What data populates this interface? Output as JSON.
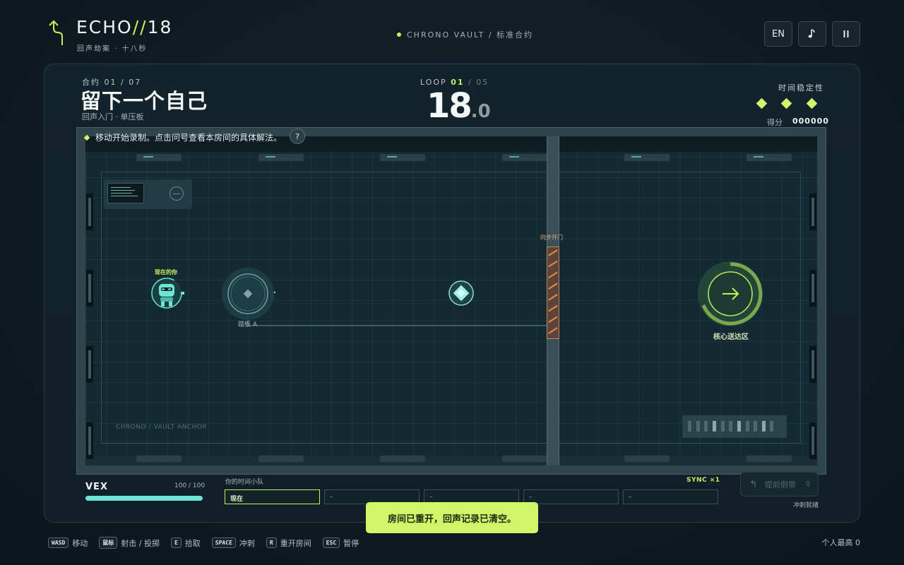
{
  "header": {
    "title_main": "ECHO",
    "title_slash": "//",
    "title_num": "18",
    "subtitle": "回声劫案 · 十八秒",
    "status": "CHRONO VAULT / 标准合约",
    "buttons": {
      "language": "EN",
      "music_icon": "music-note-icon",
      "pause_icon": "pause-icon"
    }
  },
  "contract": {
    "number": "合约 01 / 07",
    "title": "留下一个自己",
    "subtitle": "回声入门 · 单压板"
  },
  "loop": {
    "label": "LOOP",
    "current": "01",
    "sep": " / ",
    "total": "05"
  },
  "timer": {
    "whole": "18",
    "decimal": ".0"
  },
  "stability": {
    "label": "时间稳定性",
    "level": 3,
    "max": 3
  },
  "score": {
    "label": "得分",
    "value": "000000"
  },
  "tip": {
    "text": "移动开始录制。点击问号查看本房间的具体解法。",
    "help": "?"
  },
  "arena": {
    "player_label": "现在的你",
    "plate_label": "踏板 A",
    "door_label": "同步开门",
    "goal_label": "核心送达区",
    "anchor_text": "CHRONO / VAULT  ANCHOR"
  },
  "hud": {
    "name": "VEX",
    "hp_text": "100 / 100",
    "hp": 100,
    "hp_max": 100,
    "squad_label": "你的时间小队",
    "sync": "SYNC ×1",
    "slots": [
      "现在",
      "–",
      "–",
      "–",
      "–"
    ],
    "rewind_label": "提前倒带",
    "dash_status": "冲刺就绪"
  },
  "toast": "房间已重开，回声记录已清空。",
  "footer": {
    "hints": [
      {
        "key": "WASD",
        "action": "移动"
      },
      {
        "key": "鼠标",
        "action": "射击 / 投掷"
      },
      {
        "key": "E",
        "action": "拾取"
      },
      {
        "key": "SPACE",
        "action": "冲刺"
      },
      {
        "key": "R",
        "action": "重开房间"
      },
      {
        "key": "ESC",
        "action": "暂停"
      }
    ],
    "best": "个人最高 0"
  },
  "colors": {
    "accent": "#c4f25a",
    "cyan": "#6fe3d6",
    "door": "#e0894a"
  }
}
